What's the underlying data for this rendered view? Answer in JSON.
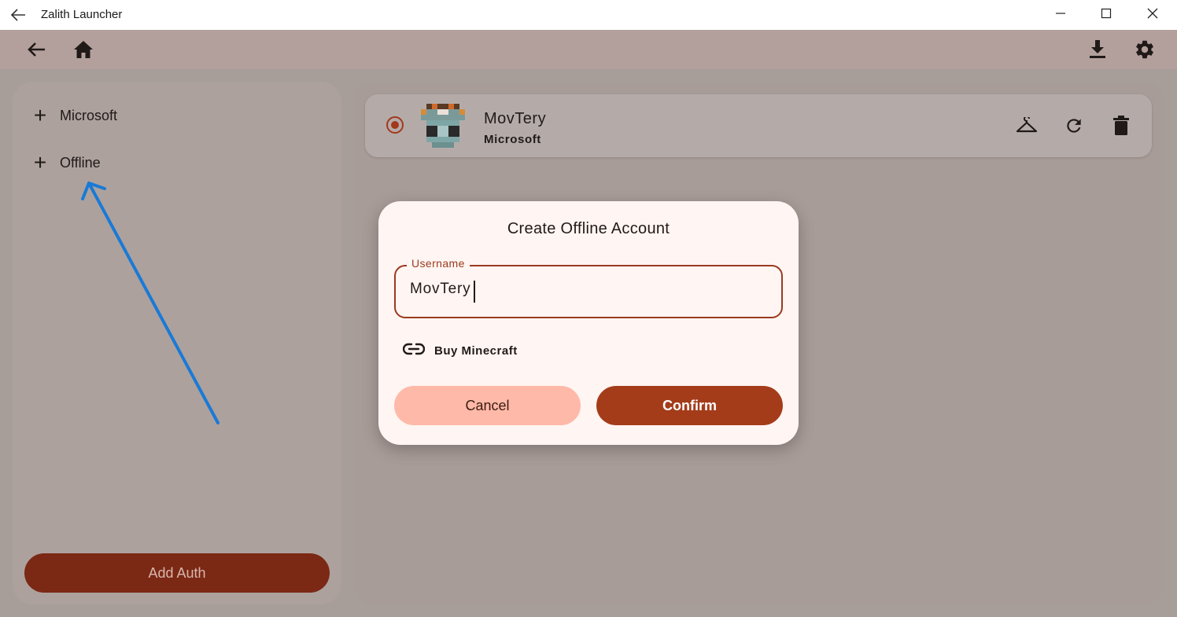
{
  "window": {
    "title": "Zalith Launcher",
    "back_icon": "arrow-left-icon",
    "controls": [
      "minimize-icon",
      "maximize-icon",
      "close-icon"
    ]
  },
  "app_bar": {
    "left_icons": [
      "back-arrow-icon",
      "home-icon"
    ],
    "right_icons": [
      "download-icon",
      "settings-gear-icon"
    ]
  },
  "sidebar": {
    "items": [
      {
        "icon": "plus-icon",
        "label": "Microsoft"
      },
      {
        "icon": "plus-icon",
        "label": "Offline"
      }
    ],
    "add_auth_label": "Add Auth"
  },
  "account": {
    "name": "MovTery",
    "type": "Microsoft",
    "selected": true,
    "actions": [
      "hanger-skin-icon",
      "refresh-icon",
      "trash-icon"
    ]
  },
  "dialog": {
    "title": "Create Offline Account",
    "username_label": "Username",
    "username_value": "MovTery",
    "buy_link": "Buy Minecraft",
    "cancel_label": "Cancel",
    "confirm_label": "Confirm"
  },
  "colors": {
    "accent": "#a43c1a",
    "add_auth_bg": "#7b2815",
    "cancel_bg": "#ffb9a8",
    "annotation_arrow": "#1a7ad6"
  }
}
